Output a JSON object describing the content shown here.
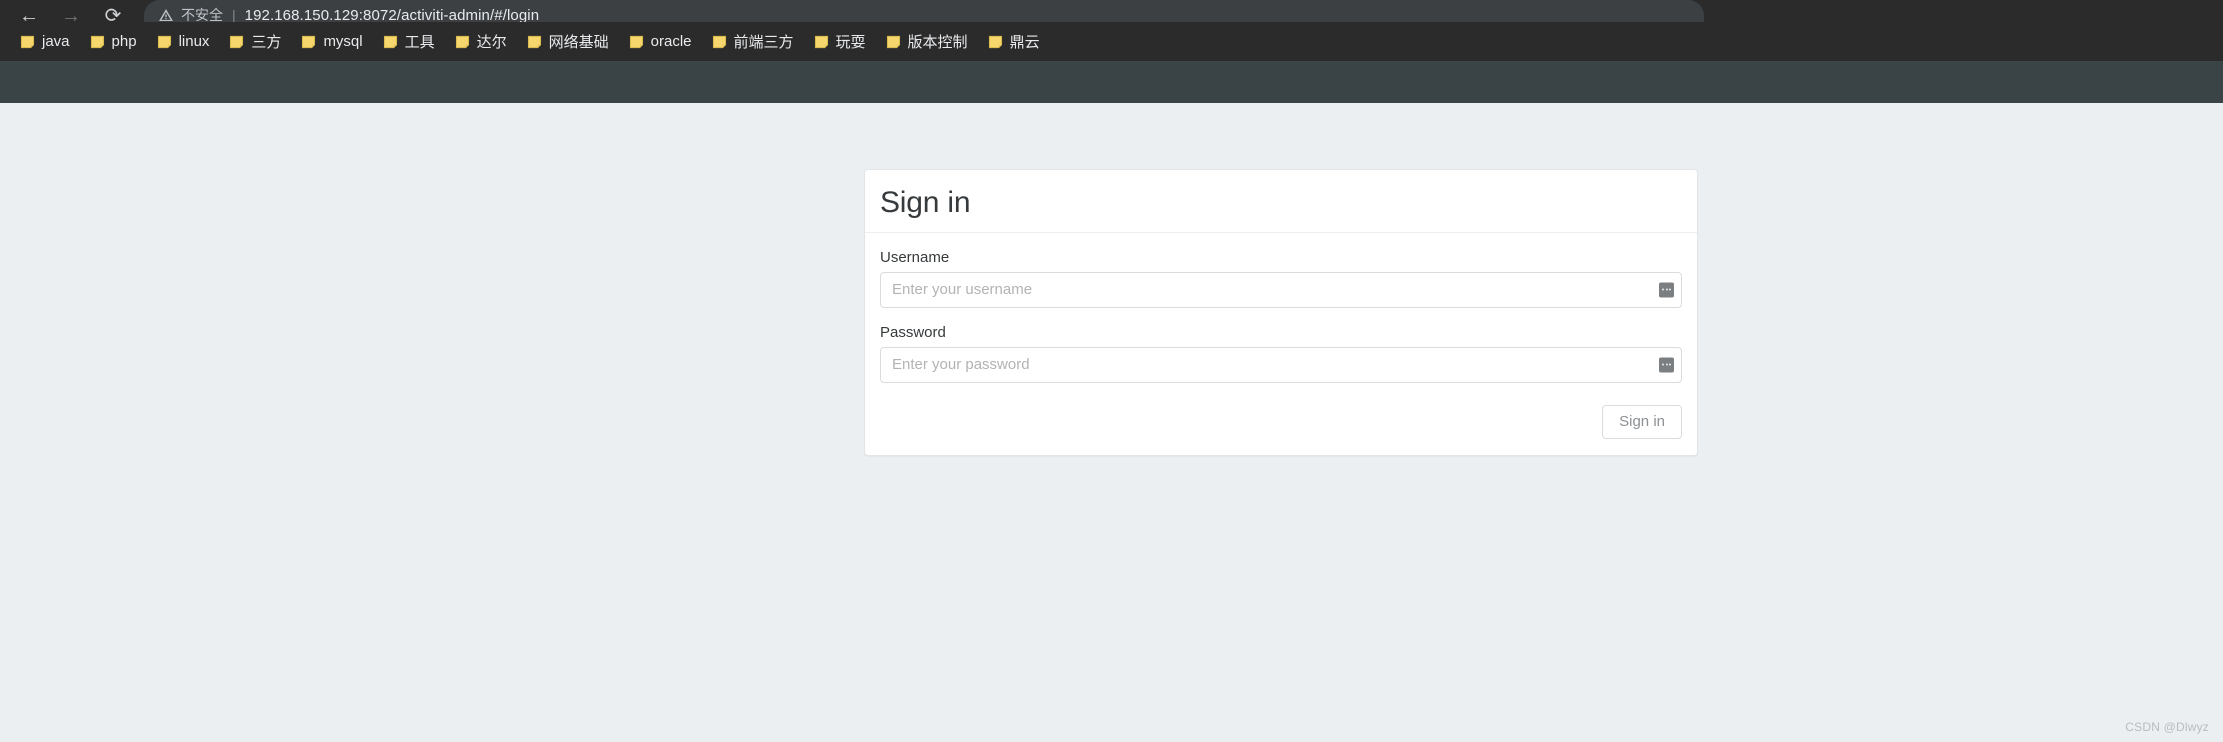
{
  "browser": {
    "nav": {
      "back_icon": "arrow-left-icon",
      "forward_icon": "arrow-right-icon",
      "reload_icon": "reload-icon",
      "back_label": "←",
      "forward_label": "→",
      "reload_label": "⟳"
    },
    "omnibox": {
      "security_icon": "warning-triangle-icon",
      "security_text": "不安全",
      "divider": "|",
      "url_host": "192.168.150.129",
      "url_rest": ":8072/activiti-admin/#/login",
      "url_full": "192.168.150.129:8072/activiti-admin/#/login"
    },
    "bookmarks": [
      {
        "label": "java",
        "icon": "folder-icon"
      },
      {
        "label": "php",
        "icon": "folder-icon"
      },
      {
        "label": "linux",
        "icon": "folder-icon"
      },
      {
        "label": "三方",
        "icon": "folder-icon"
      },
      {
        "label": "mysql",
        "icon": "folder-icon"
      },
      {
        "label": "工具",
        "icon": "folder-icon"
      },
      {
        "label": "达尔",
        "icon": "folder-icon"
      },
      {
        "label": "网络基础",
        "icon": "folder-icon"
      },
      {
        "label": "oracle",
        "icon": "folder-icon"
      },
      {
        "label": "前端三方",
        "icon": "folder-icon"
      },
      {
        "label": "玩耍",
        "icon": "folder-icon"
      },
      {
        "label": "版本控制",
        "icon": "folder-icon"
      },
      {
        "label": "鼎云",
        "icon": "folder-icon"
      }
    ]
  },
  "signin": {
    "title": "Sign in",
    "username": {
      "label": "Username",
      "placeholder": "Enter your username",
      "value": "",
      "autofill_icon": "autofill-icon"
    },
    "password": {
      "label": "Password",
      "placeholder": "Enter your password",
      "value": "",
      "autofill_icon": "autofill-icon"
    },
    "submit_label": "Sign in"
  },
  "watermark": "CSDN @Dlwyz",
  "colors": {
    "chrome_bg": "#2b2b2b",
    "omnibox_bg": "#3c4043",
    "app_header_bg": "#3a4346",
    "page_bg": "#eceff1",
    "card_bg": "#ffffff",
    "folder_yellow": "#f5d76e",
    "text_dark": "#373a3c"
  }
}
